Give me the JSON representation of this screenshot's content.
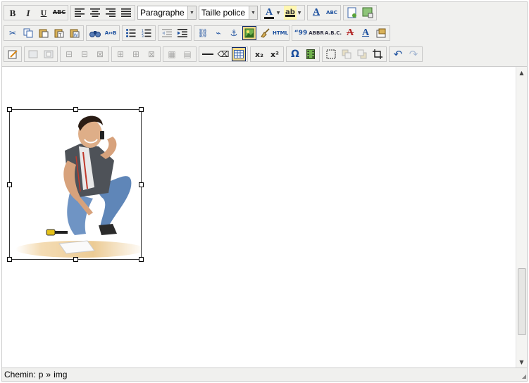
{
  "toolbar": {
    "row1": {
      "bold": "B",
      "italic": "I",
      "underline": "U",
      "strike": "ABC",
      "block_format_value": "Paragraphe",
      "font_size_value": "Taille police",
      "text_color_glyph": "A",
      "highlight_glyph": "ab",
      "styles_glyph": "A",
      "spellcheck_glyph": "ABC"
    },
    "row2": {
      "html_label": "HTML",
      "quote_label": "“99",
      "abbr_label": "ABBR",
      "acronym_label": "A.B.C.",
      "del_glyph": "A",
      "ins_glyph": "A"
    },
    "row3": {
      "subscript": "x₂",
      "superscript": "x²",
      "omega": "Ω"
    }
  },
  "statusbar": {
    "prefix": "Chemin:",
    "path": [
      "p",
      "img"
    ],
    "separator": "»"
  },
  "colors": {
    "toolbar_bg": "#f0f0ee",
    "border": "#cccccc",
    "active_button": "#f2d98a"
  }
}
